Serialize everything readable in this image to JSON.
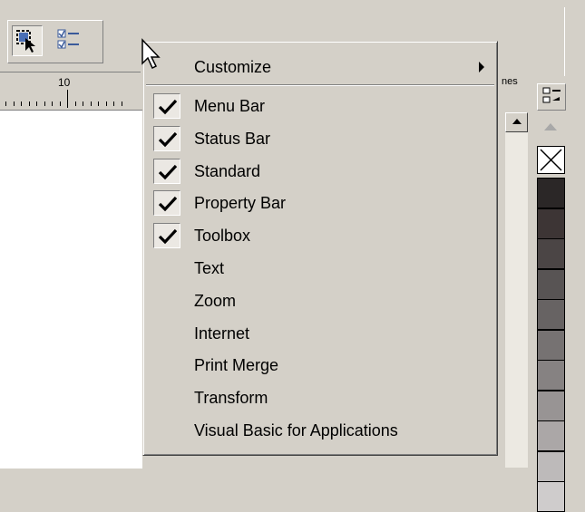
{
  "ruler": {
    "label": "10"
  },
  "side_ruler": {
    "label": "nes"
  },
  "menu": {
    "customize": "Customize",
    "items": [
      {
        "label": "Menu Bar",
        "checked": true
      },
      {
        "label": "Status Bar",
        "checked": true
      },
      {
        "label": "Standard",
        "checked": true
      },
      {
        "label": "Property Bar",
        "checked": true
      },
      {
        "label": "Toolbox",
        "checked": true
      },
      {
        "label": "Text",
        "checked": false
      },
      {
        "label": "Zoom",
        "checked": false
      },
      {
        "label": "Internet",
        "checked": false
      },
      {
        "label": "Print Merge",
        "checked": false
      },
      {
        "label": "Transform",
        "checked": false
      },
      {
        "label": "Visual Basic for Applications",
        "checked": false
      }
    ]
  },
  "icons": {
    "toolbar": [
      "pick-tool-icon",
      "options-list-icon"
    ],
    "menu": [
      "checkmark-icon",
      "submenu-arrow-icon"
    ],
    "palette": [
      "palette-options-icon",
      "scroll-up-icon",
      "no-fill-icon"
    ],
    "cursor": "mouse-pointer-icon"
  },
  "palette": {
    "swatches": [
      "#2b2727",
      "#3d3535",
      "#4b4545",
      "#585454",
      "#676363",
      "#767272",
      "#868282",
      "#989494",
      "#aba7a7",
      "#bdbaba",
      "#cfcccc"
    ]
  },
  "colors": {
    "menu_bg": "#d4d0c8",
    "check_bg": "#ebe8e3",
    "canvas": "#ffffff"
  }
}
